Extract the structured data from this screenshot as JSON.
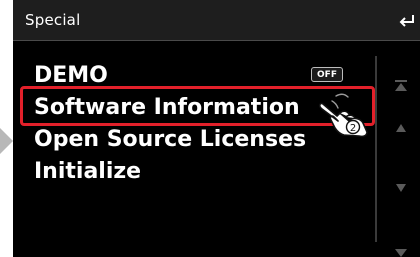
{
  "header": {
    "title": "Special"
  },
  "menu": {
    "items": [
      {
        "label": "DEMO",
        "badge": "OFF"
      },
      {
        "label": "Software Information"
      },
      {
        "label": "Open Source Licenses"
      },
      {
        "label": "Initialize"
      }
    ]
  },
  "callout": {
    "step_number": "2"
  },
  "icons": {
    "back": "back-arrow-icon",
    "scroll_top": "double-triangle-up-icon",
    "scroll_up": "triangle-up-icon",
    "scroll_down": "triangle-down-icon",
    "scroll_bottom": "double-triangle-down-icon",
    "pointer": "tapping-hand-icon"
  },
  "colors": {
    "background": "#000000",
    "header": "#1e1e1e",
    "highlight": "#e2202a",
    "text": "#ffffff"
  }
}
